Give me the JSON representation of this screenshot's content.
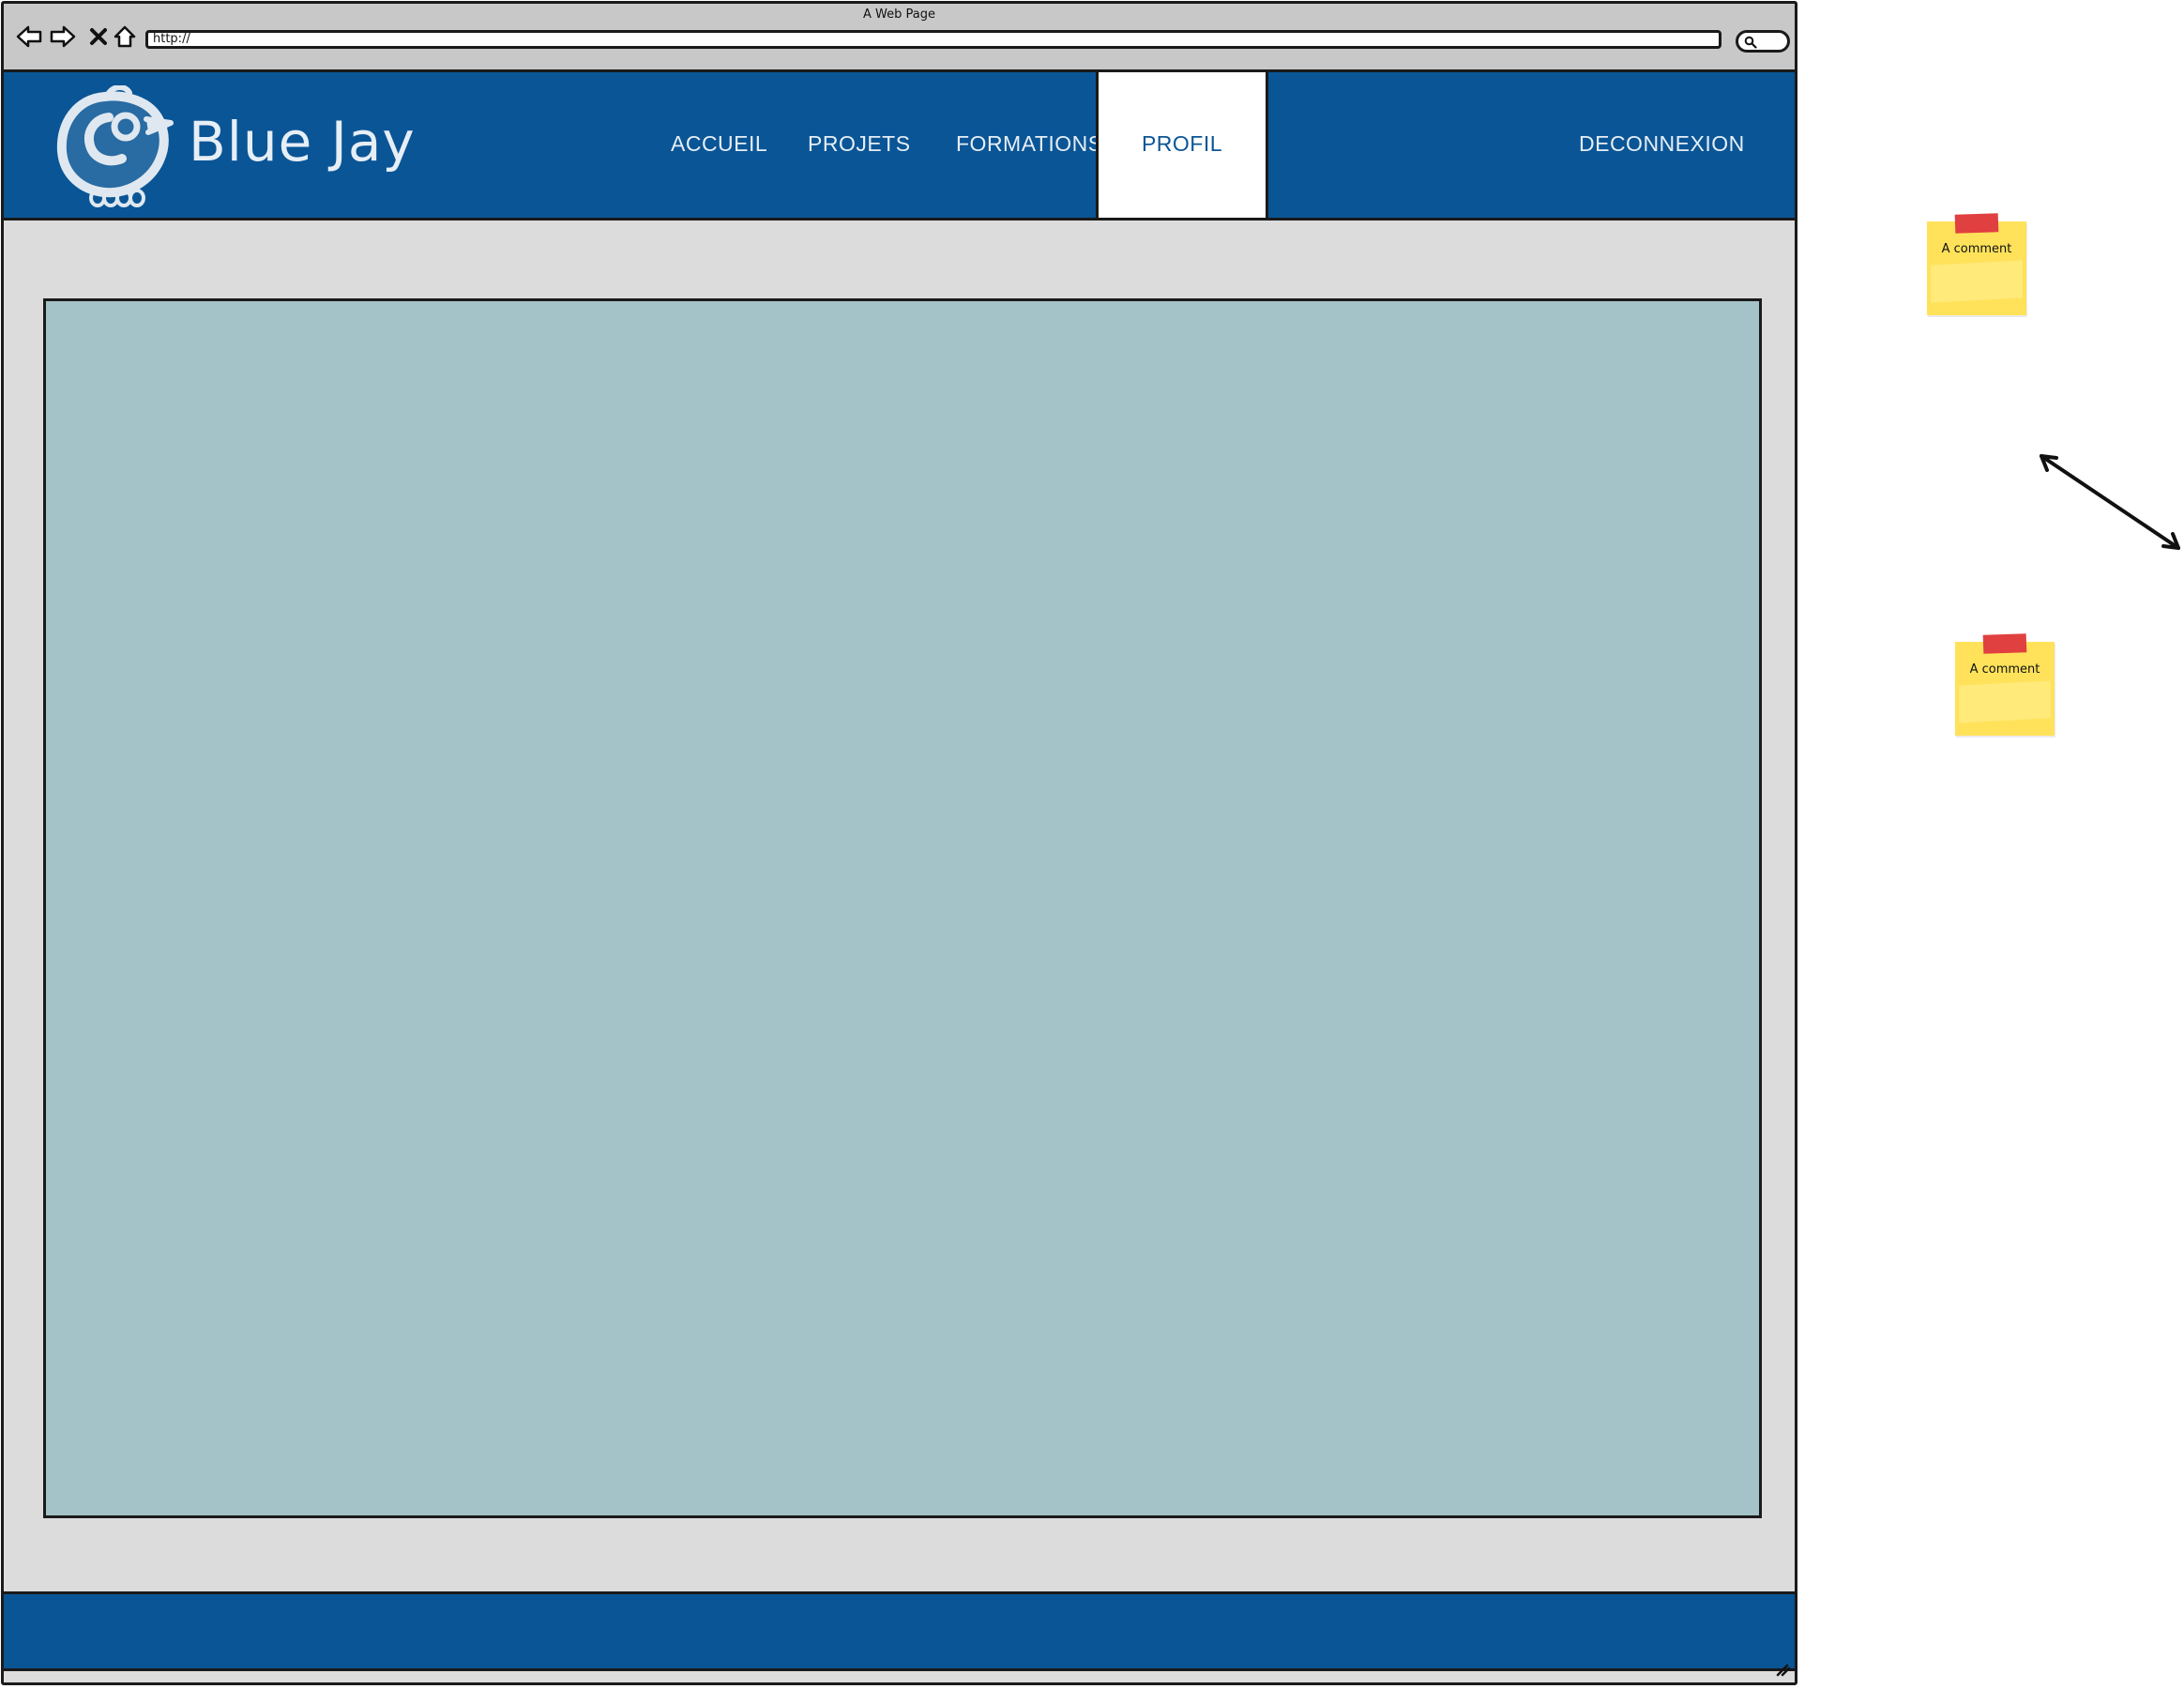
{
  "window": {
    "title": "A Web Page",
    "url": "http://"
  },
  "site": {
    "brand": "Blue Jay",
    "nav": {
      "accueil": "ACCUEIL",
      "projets": "PROJETS",
      "formations": "FORMATIONS",
      "profil": "PROFIL",
      "deconnexion": "DECONNEXION"
    },
    "active_tab": "PROFIL"
  },
  "notes": [
    {
      "text": "A comment"
    },
    {
      "text": "A comment"
    }
  ],
  "colors": {
    "brand_blue": "#0a5596",
    "content_panel": "#a4c3c8",
    "page_background": "#dcdcdc",
    "sticky_yellow": "#ffe25a",
    "sticky_tape": "#e04040"
  }
}
